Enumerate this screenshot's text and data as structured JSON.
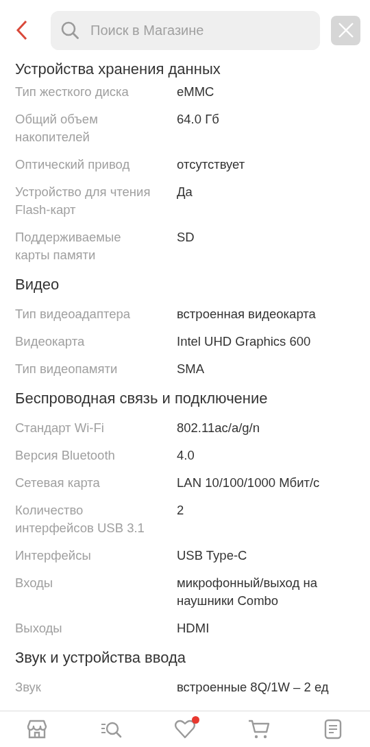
{
  "search": {
    "placeholder": "Поиск в Магазине"
  },
  "sections": [
    {
      "title": "Устройства хранения данных",
      "rows": [
        {
          "label": "Тип жесткого диска",
          "value": "eMMC"
        },
        {
          "label": "Общий объем накопителей",
          "value": "64.0 Гб"
        },
        {
          "label": "Оптический привод",
          "value": "отсутствует"
        },
        {
          "label": "Устройство для чтения Flash-карт",
          "value": "Да"
        },
        {
          "label": "Поддерживаемые карты памяти",
          "value": "SD"
        }
      ]
    },
    {
      "title": "Видео",
      "rows": [
        {
          "label": "Тип видеоадаптера",
          "value": "встроенная видеокарта"
        },
        {
          "label": "Видеокарта",
          "value": "Intel UHD Graphics 600"
        },
        {
          "label": "Тип видеопамяти",
          "value": "SMA"
        }
      ]
    },
    {
      "title": "Беспроводная связь и подключение",
      "rows": [
        {
          "label": "Стандарт Wi-Fi",
          "value": "802.11ac/a/g/n"
        },
        {
          "label": "Версия Bluetooth",
          "value": "4.0"
        },
        {
          "label": "Сетевая карта",
          "value": "LAN 10/100/1000 Мбит/с"
        },
        {
          "label": "Количество интерфейсов USB 3.1",
          "value": "2"
        },
        {
          "label": "Интерфейсы",
          "value": "USB Type-C"
        },
        {
          "label": "Входы",
          "value": "микрофонный/выход на наушники Combo"
        },
        {
          "label": "Выходы",
          "value": "HDMI"
        }
      ]
    },
    {
      "title": "Звук и устройства ввода",
      "rows": [
        {
          "label": "Звук",
          "value": "встроенные 8Q/1W – 2 ед"
        }
      ]
    }
  ],
  "nav": [
    {
      "kind": "store",
      "dot": false
    },
    {
      "kind": "catalog",
      "dot": false
    },
    {
      "kind": "favorites",
      "dot": true
    },
    {
      "kind": "cart",
      "dot": false
    },
    {
      "kind": "orders",
      "dot": false
    }
  ]
}
